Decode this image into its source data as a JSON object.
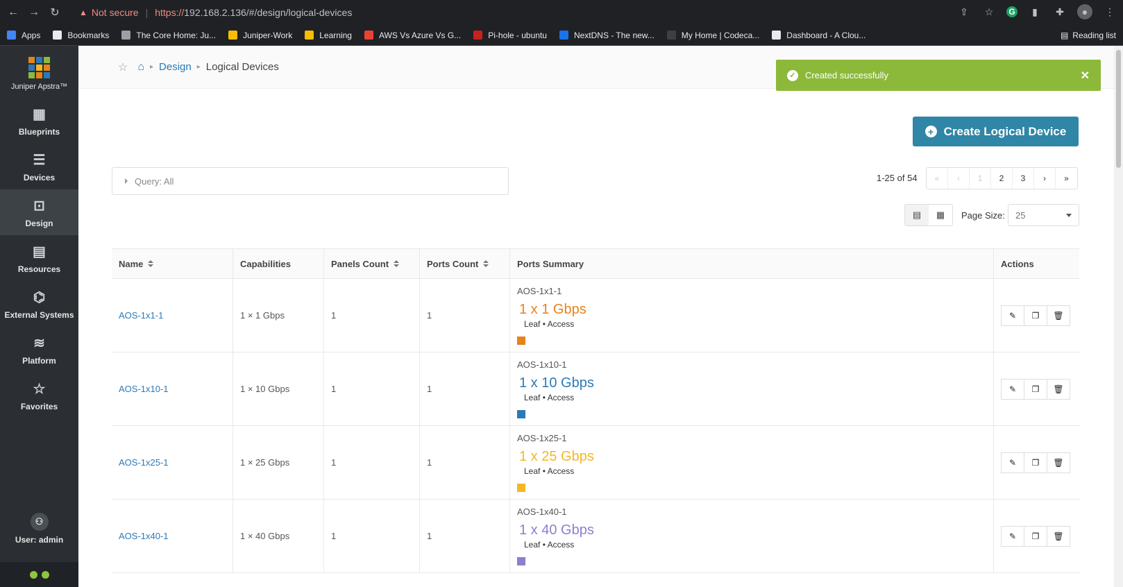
{
  "browser": {
    "warning_text": "Not secure",
    "url_scheme": "https://",
    "url_rest": "192.168.2.136/#/design/logical-devices",
    "bookmarks": [
      {
        "label": "Apps",
        "color": "#4285f4"
      },
      {
        "label": "Bookmarks",
        "color": "#e8eaed"
      },
      {
        "label": "The Core Home: Ju...",
        "color": "#9aa0a6"
      },
      {
        "label": "Juniper-Work",
        "color": "#fbbc04"
      },
      {
        "label": "Learning",
        "color": "#fbbc04"
      },
      {
        "label": "AWS Vs Azure Vs G...",
        "color": "#ea4335"
      },
      {
        "label": "Pi-hole - ubuntu",
        "color": "#c5221f"
      },
      {
        "label": "NextDNS - The new...",
        "color": "#1a73e8"
      },
      {
        "label": "My Home | Codeca...",
        "color": "#3c4043"
      },
      {
        "label": "Dashboard - A Clou...",
        "color": "#e8eaed"
      }
    ],
    "reading_list": "Reading list"
  },
  "sidebar": {
    "brand": "Juniper Apstra™",
    "items": [
      {
        "label": "Blueprints",
        "icon": "blueprints-icon",
        "glyph": "▦"
      },
      {
        "label": "Devices",
        "icon": "devices-icon",
        "glyph": "☰"
      },
      {
        "label": "Design",
        "icon": "design-icon",
        "glyph": "⊡"
      },
      {
        "label": "Resources",
        "icon": "resources-icon",
        "glyph": "▤"
      },
      {
        "label": "External Systems",
        "icon": "external-systems-icon",
        "glyph": "⌬"
      },
      {
        "label": "Platform",
        "icon": "platform-icon",
        "glyph": "≋"
      },
      {
        "label": "Favorites",
        "icon": "favorites-icon",
        "glyph": "☆"
      }
    ],
    "user": "User: admin"
  },
  "breadcrumb": {
    "design": "Design",
    "current": "Logical Devices"
  },
  "toast": {
    "message": "Created successfully"
  },
  "create_button": "Create Logical Device",
  "query": "Query: All",
  "pager": {
    "range": "1-25",
    "of": " of ",
    "total": "54",
    "pages": [
      "1",
      "2",
      "3"
    ]
  },
  "page_size": {
    "label": "Page Size:",
    "value": "25"
  },
  "table": {
    "headers": {
      "name": "Name",
      "capabilities": "Capabilities",
      "panels": "Panels Count",
      "ports": "Ports Count",
      "summary": "Ports Summary",
      "actions": "Actions"
    },
    "rows": [
      {
        "name": "AOS-1x1-1",
        "capabilities": "1 × 1 Gbps",
        "panels": "1",
        "ports": "1",
        "sum_name": "AOS-1x1-1",
        "speed": "1 x 1 Gbps",
        "roles": "Leaf • Access",
        "color": "#e8821a"
      },
      {
        "name": "AOS-1x10-1",
        "capabilities": "1 × 10 Gbps",
        "panels": "1",
        "ports": "1",
        "sum_name": "AOS-1x10-1",
        "speed": "1 x 10 Gbps",
        "roles": "Leaf • Access",
        "color": "#2a7ab8"
      },
      {
        "name": "AOS-1x25-1",
        "capabilities": "1 × 25 Gbps",
        "panels": "1",
        "ports": "1",
        "sum_name": "AOS-1x25-1",
        "speed": "1 x 25 Gbps",
        "roles": "Leaf • Access",
        "color": "#f2b824"
      },
      {
        "name": "AOS-1x40-1",
        "capabilities": "1 × 40 Gbps",
        "panels": "1",
        "ports": "1",
        "sum_name": "AOS-1x40-1",
        "speed": "1 x 40 Gbps",
        "roles": "Leaf • Access",
        "color": "#8c7fd0"
      }
    ]
  }
}
